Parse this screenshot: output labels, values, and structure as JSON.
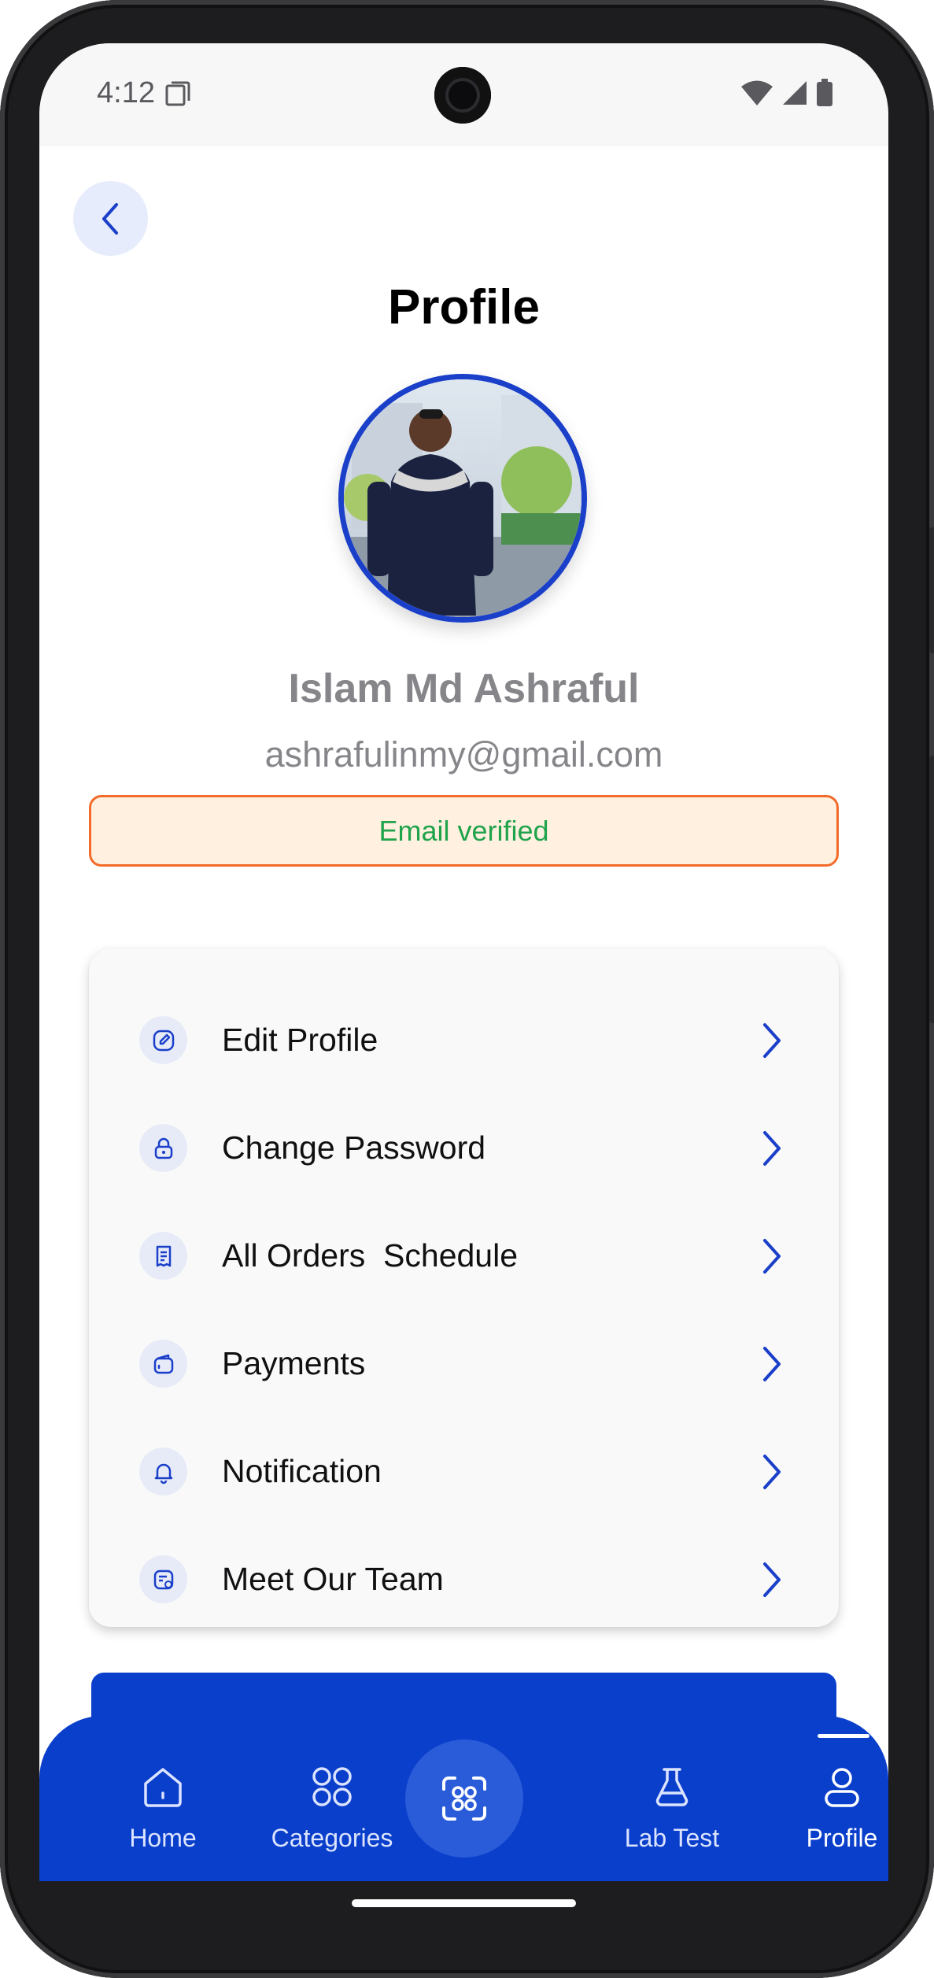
{
  "status_bar": {
    "time": "4:12"
  },
  "header": {
    "title": "Profile"
  },
  "profile": {
    "name": "Islam Md Ashraful",
    "email": "ashrafulinmy@gmail.com",
    "verification": "Email verified"
  },
  "menu": {
    "items": [
      {
        "label": "Edit Profile",
        "icon": "edit-icon"
      },
      {
        "label": "Change Password",
        "icon": "lock-icon"
      },
      {
        "label": "All Orders  Schedule",
        "icon": "receipt-icon"
      },
      {
        "label": "Payments",
        "icon": "wallet-icon"
      },
      {
        "label": "Notification",
        "icon": "bell-icon"
      },
      {
        "label": "Meet Our Team",
        "icon": "team-card-icon"
      }
    ]
  },
  "bottom_nav": {
    "home": "Home",
    "categories": "Categories",
    "lab_test": "Lab Test",
    "profile": "Profile",
    "active": "Profile"
  },
  "colors": {
    "primary": "#0a3fcb",
    "verified_text": "#1fa34b",
    "verified_border": "#f26b2a",
    "verified_bg": "#fff0df"
  }
}
